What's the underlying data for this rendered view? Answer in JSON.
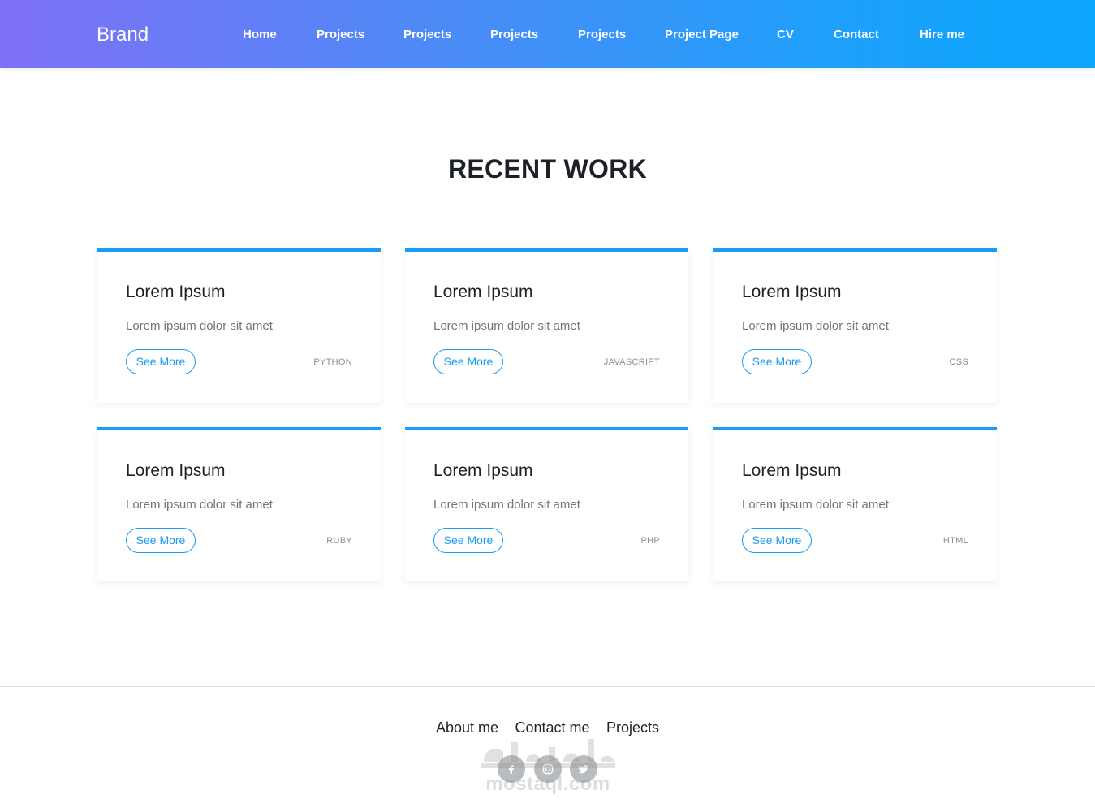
{
  "navbar": {
    "brand": "Brand",
    "links": [
      "Home",
      "Projects",
      "Projects",
      "Projects",
      "Projects",
      "Project Page",
      "CV",
      "Contact",
      "Hire me"
    ]
  },
  "main": {
    "title": "RECENT WORK",
    "cards": [
      {
        "title": "Lorem Ipsum",
        "text": "Lorem ipsum dolor sit amet",
        "button": "See More",
        "tag": "PYTHON"
      },
      {
        "title": "Lorem Ipsum",
        "text": "Lorem ipsum dolor sit amet",
        "button": "See More",
        "tag": "JAVASCRIPT"
      },
      {
        "title": "Lorem Ipsum",
        "text": "Lorem ipsum dolor sit amet",
        "button": "See More",
        "tag": "CSS"
      },
      {
        "title": "Lorem Ipsum",
        "text": "Lorem ipsum dolor sit amet",
        "button": "See More",
        "tag": "RUBY"
      },
      {
        "title": "Lorem Ipsum",
        "text": "Lorem ipsum dolor sit amet",
        "button": "See More",
        "tag": "PHP"
      },
      {
        "title": "Lorem Ipsum",
        "text": "Lorem ipsum dolor sit amet",
        "button": "See More",
        "tag": "HTML"
      }
    ]
  },
  "footer": {
    "links": [
      "About me",
      "Contact me",
      "Projects"
    ],
    "social_icons": [
      "facebook-icon",
      "instagram-icon",
      "twitter-icon"
    ]
  },
  "watermark": {
    "text": "mostaql.com"
  },
  "colors": {
    "accent": "#1a9bf5",
    "gradient_start": "#7f70f5",
    "gradient_end": "#0ba6fd"
  }
}
